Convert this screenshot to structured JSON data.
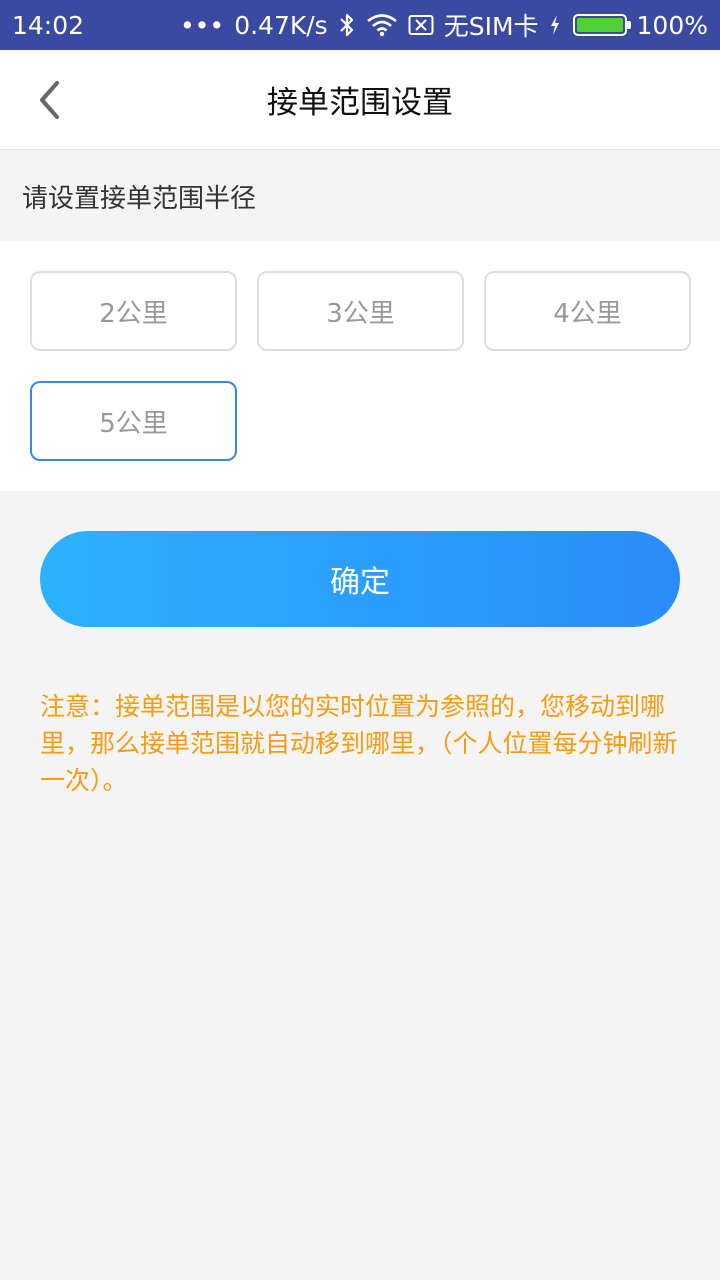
{
  "status_bar": {
    "time": "14:02",
    "dots": "•••",
    "net_speed": "0.47K/s",
    "sim_text": "无SIM卡",
    "battery_percent": "100%",
    "battery_level": 1.0
  },
  "nav": {
    "title": "接单范围设置"
  },
  "section": {
    "label": "请设置接单范围半径"
  },
  "options": [
    "2公里",
    "3公里",
    "4公里",
    "5公里"
  ],
  "selected_option": "5公里",
  "confirm_label": "确定",
  "notice": "注意：接单范围是以您的实时位置为参照的，您移动到哪里，那么接单范围就自动移到哪里，（个人位置每分钟刷新一次）。",
  "colors": {
    "status_bar": "#3a4aa0",
    "accent_blue": "#2a8cfb",
    "notice_orange": "#f79b10",
    "battery_green": "#4cd137"
  }
}
